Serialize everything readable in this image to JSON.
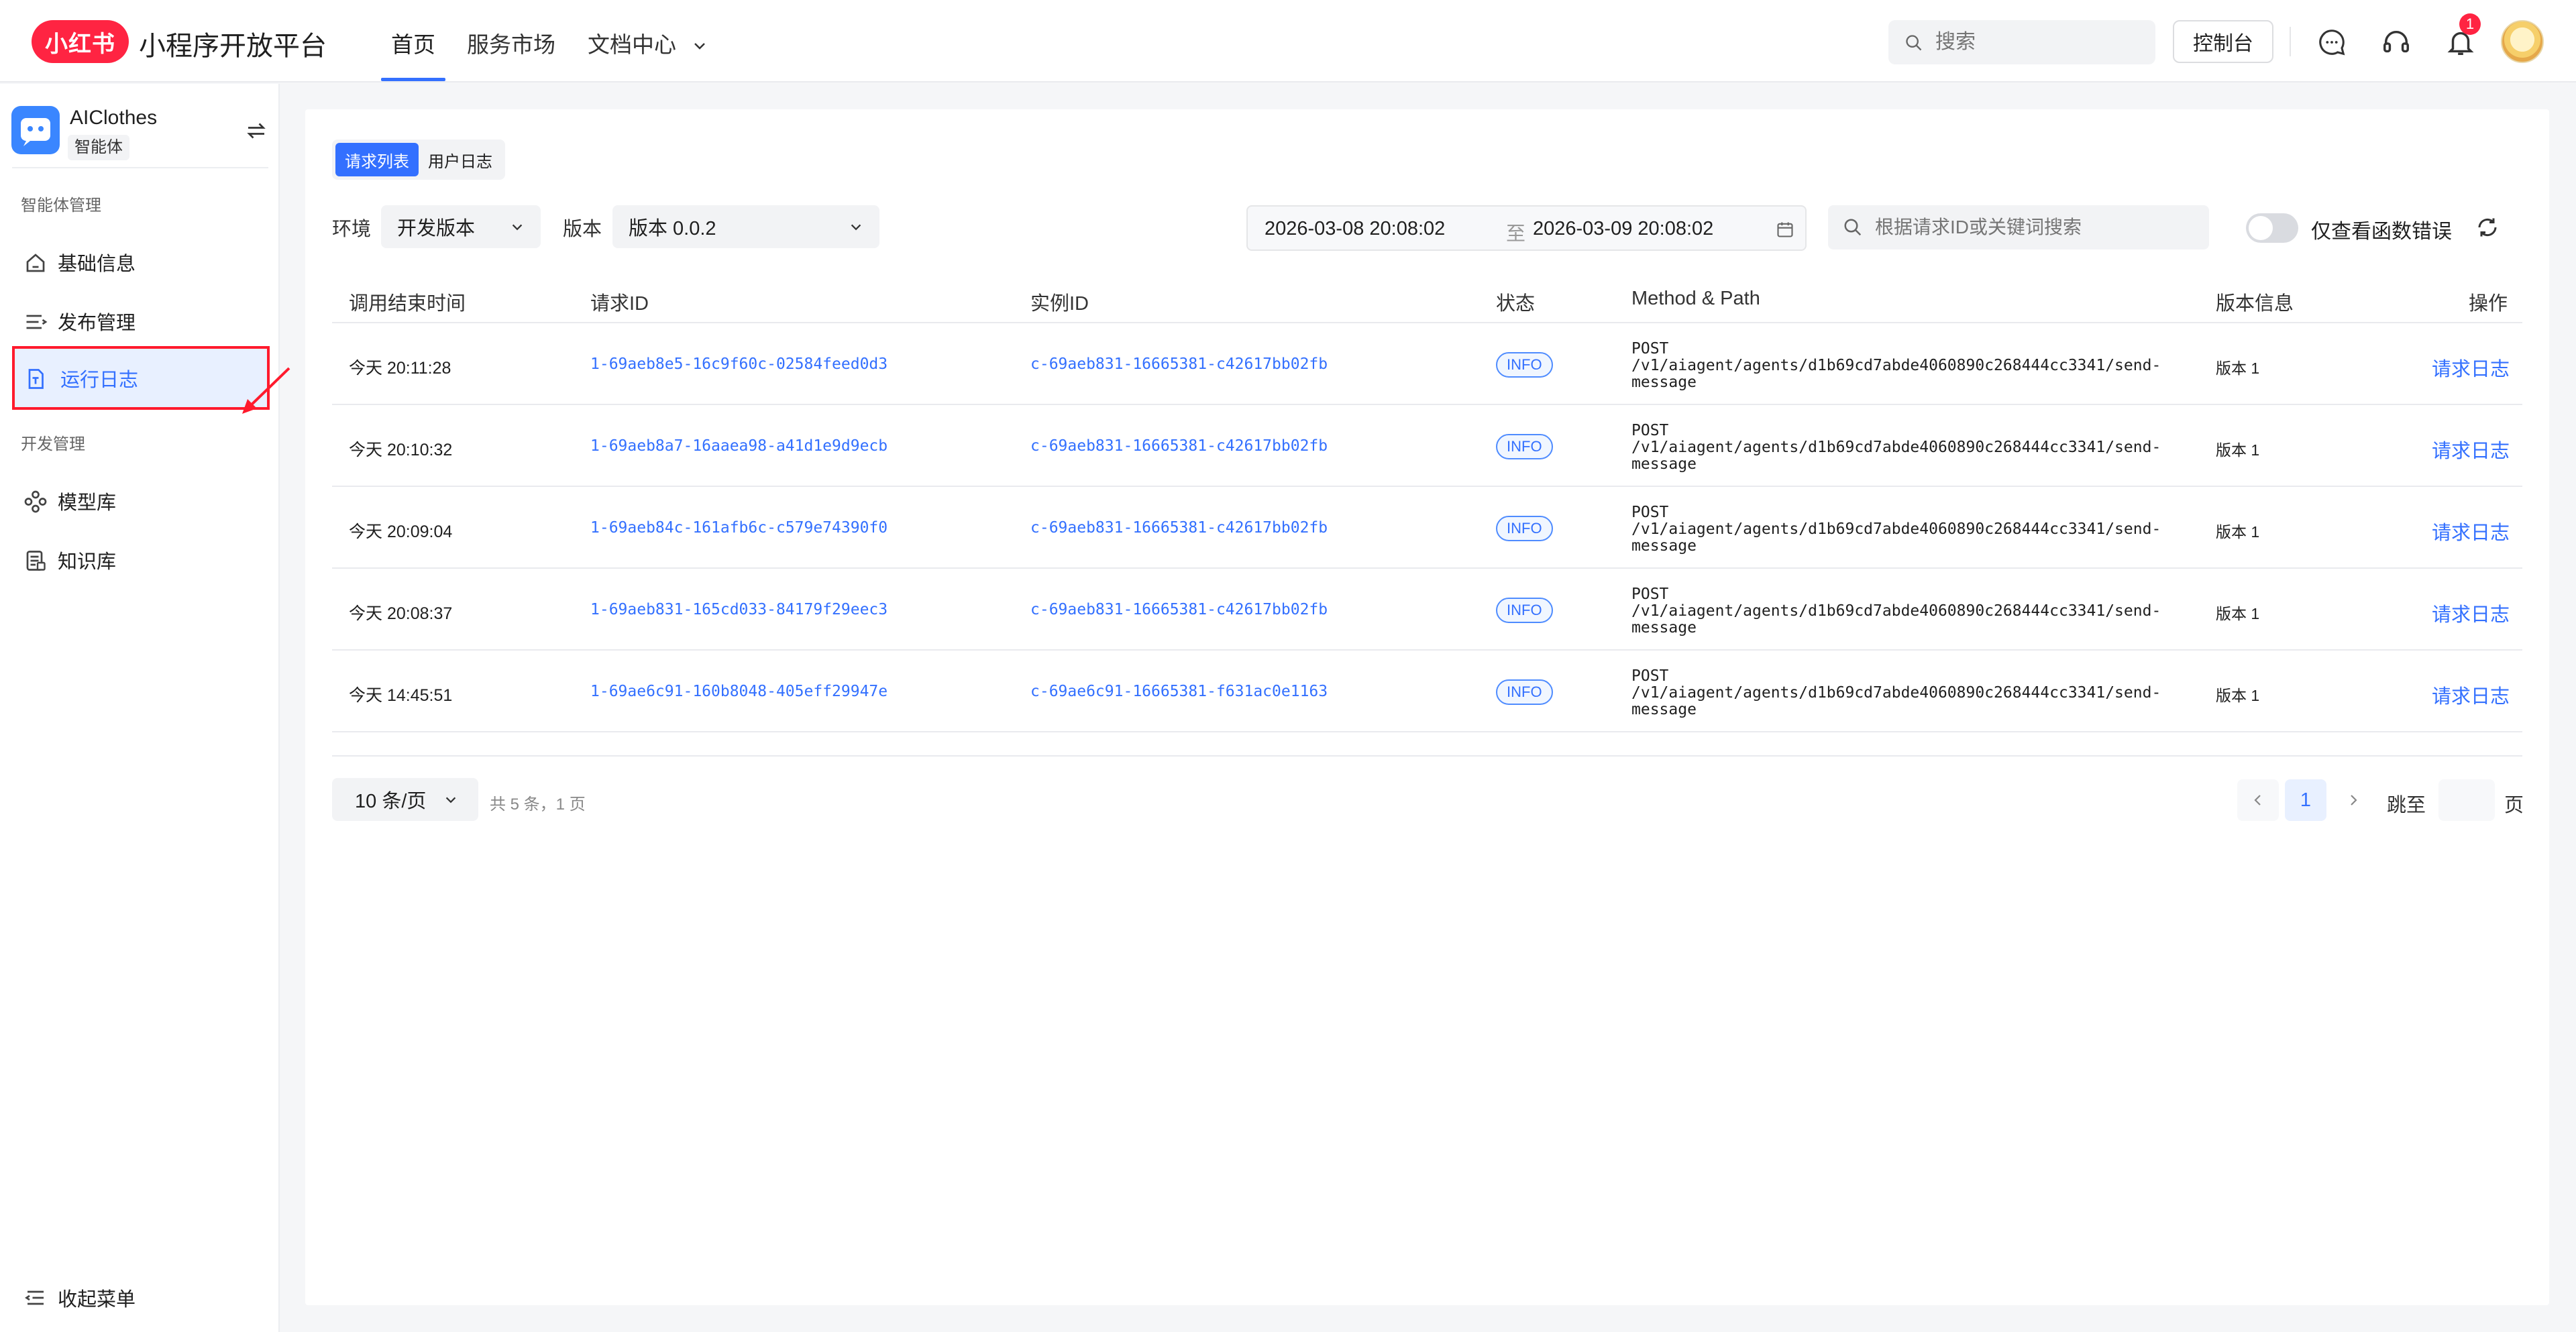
{
  "header": {
    "logo_text": "小红书",
    "brand": "小程序开放平台",
    "nav": [
      {
        "label": "首页"
      },
      {
        "label": "服务市场"
      },
      {
        "label": "文档中心"
      }
    ],
    "search_placeholder": "搜索",
    "console_label": "控制台",
    "notification_count": "1",
    "icons": [
      "search-icon",
      "chat-icon",
      "headset-icon",
      "bell-icon",
      "avatar"
    ]
  },
  "sidebar": {
    "app_name": "AIClothes",
    "app_tag": "智能体",
    "group1": "智能体管理",
    "group2": "开发管理",
    "items": [
      {
        "label": "基础信息",
        "icon": "home-icon"
      },
      {
        "label": "发布管理",
        "icon": "list-icon"
      },
      {
        "label": "运行日志",
        "icon": "log-file-icon"
      },
      {
        "label": "模型库",
        "icon": "model-icon"
      },
      {
        "label": "知识库",
        "icon": "knowledge-icon"
      }
    ],
    "collapse_label": "收起菜单"
  },
  "tabs": [
    {
      "label": "请求列表"
    },
    {
      "label": "用户日志"
    }
  ],
  "filters": {
    "env_label": "环境",
    "env_value": "开发版本",
    "version_label": "版本",
    "version_value": "版本 0.0.2",
    "date_start": "2026-03-08 20:08:02",
    "date_sep": "至",
    "date_end": "2026-03-09 20:08:02",
    "search_placeholder": "根据请求ID或关键词搜索",
    "toggle_label": "仅查看函数错误"
  },
  "table": {
    "columns": [
      "调用结束时间",
      "请求ID",
      "实例ID",
      "状态",
      "Method & Path",
      "版本信息",
      "操作"
    ],
    "rows": [
      {
        "time": "今天 20:11:28",
        "request_id": "1-69aeb8e5-16c9f60c-02584feed0d3",
        "instance_id": "c-69aeb831-16665381-c42617bb02fb",
        "status": "INFO",
        "method": "POST",
        "path1": "/v1/aiagent/agents/d1b69cd7abde4060890c268444cc3341/send-",
        "path2": "message",
        "version": "版本 1",
        "op": "请求日志"
      },
      {
        "time": "今天 20:10:32",
        "request_id": "1-69aeb8a7-16aaea98-a41d1e9d9ecb",
        "instance_id": "c-69aeb831-16665381-c42617bb02fb",
        "status": "INFO",
        "method": "POST",
        "path1": "/v1/aiagent/agents/d1b69cd7abde4060890c268444cc3341/send-",
        "path2": "message",
        "version": "版本 1",
        "op": "请求日志"
      },
      {
        "time": "今天 20:09:04",
        "request_id": "1-69aeb84c-161afb6c-c579e74390f0",
        "instance_id": "c-69aeb831-16665381-c42617bb02fb",
        "status": "INFO",
        "method": "POST",
        "path1": "/v1/aiagent/agents/d1b69cd7abde4060890c268444cc3341/send-",
        "path2": "message",
        "version": "版本 1",
        "op": "请求日志"
      },
      {
        "time": "今天 20:08:37",
        "request_id": "1-69aeb831-165cd033-84179f29eec3",
        "instance_id": "c-69aeb831-16665381-c42617bb02fb",
        "status": "INFO",
        "method": "POST",
        "path1": "/v1/aiagent/agents/d1b69cd7abde4060890c268444cc3341/send-",
        "path2": "message",
        "version": "版本 1",
        "op": "请求日志"
      },
      {
        "time": "今天 14:45:51",
        "request_id": "1-69ae6c91-160b8048-405eff29947e",
        "instance_id": "c-69ae6c91-16665381-f631ac0e1163",
        "status": "INFO",
        "method": "POST",
        "path1": "/v1/aiagent/agents/d1b69cd7abde4060890c268444cc3341/send-",
        "path2": "message",
        "version": "版本 1",
        "op": "请求日志"
      }
    ]
  },
  "pagination": {
    "page_size": "10 条/页",
    "info": "共 5 条，1 页",
    "current": "1",
    "jump_label": "跳至",
    "page_label": "页"
  },
  "colors": {
    "brand_red": "#ff2442",
    "accent_blue": "#3370ff",
    "highlight_border": "#ff1a2d"
  }
}
